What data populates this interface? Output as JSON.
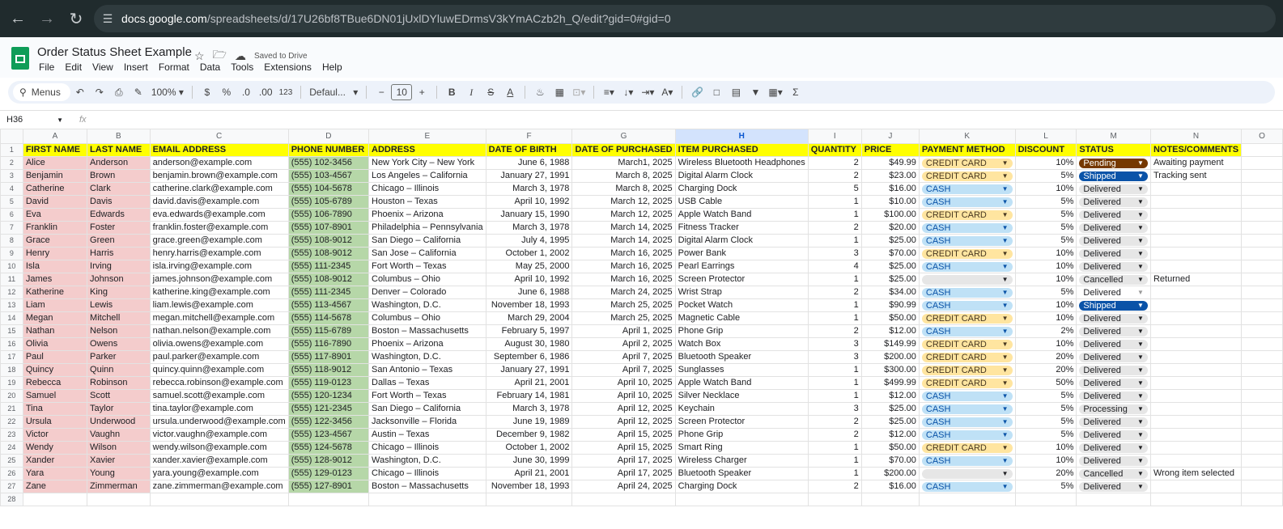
{
  "browser": {
    "url_domain": "docs.google.com",
    "url_path": "/spreadsheets/d/17U26bf8TBue6DN01jUxlDYluwEDrmsV3kYmACzb2h_Q/edit?gid=0#gid=0"
  },
  "doc": {
    "title": "Order Status Sheet Example",
    "saved": "Saved to Drive",
    "menu": [
      "File",
      "Edit",
      "View",
      "Insert",
      "Format",
      "Data",
      "Tools",
      "Extensions",
      "Help"
    ]
  },
  "toolbar": {
    "menus": "Menus",
    "zoom": "100%",
    "currency": "$",
    "percent": "%",
    "dec_dec": ".0",
    "dec_inc": ".00",
    "fmt123": "123",
    "font": "Defaul...",
    "font_size": "10"
  },
  "formula_bar": {
    "cell": "H36",
    "fx": "fx"
  },
  "columns": [
    "A",
    "B",
    "C",
    "D",
    "E",
    "F",
    "G",
    "H",
    "I",
    "J",
    "K",
    "L",
    "M",
    "N",
    "O"
  ],
  "headers": [
    "FIRST NAME",
    "LAST NAME",
    "EMAIL ADDRESS",
    "PHONE NUMBER",
    "ADDRESS",
    "DATE OF BIRTH",
    "DATE OF PURCHASED",
    "ITEM PURCHASED",
    "QUANTITY",
    "PRICE",
    "PAYMENT METHOD",
    "DISCOUNT",
    "STATUS",
    "NOTES/COMMENTS"
  ],
  "rows": [
    [
      "Alice",
      "Anderson",
      "anderson@example.com",
      "(555) 102-3456",
      "New York City – New York",
      "June 6, 1988",
      "March1, 2025",
      "Wireless Bluetooth Headphones",
      "2",
      "$49.99",
      "CREDIT CARD",
      "10%",
      "Pending",
      "Awaiting payment"
    ],
    [
      "Benjamin",
      "Brown",
      "benjamin.brown@example.com",
      "(555) 103-4567",
      "Los Angeles – California",
      "January 27, 1991",
      "March 8, 2025",
      "Digital Alarm Clock",
      "2",
      "$23.00",
      "CREDIT CARD",
      "5%",
      "Shipped",
      "Tracking sent"
    ],
    [
      "Catherine",
      "Clark",
      "catherine.clark@example.com",
      "(555) 104-5678",
      "Chicago – Illinois",
      "March 3, 1978",
      "March 8, 2025",
      "Charging Dock",
      "5",
      "$16.00",
      "CASH",
      "10%",
      "Delivered",
      ""
    ],
    [
      "David",
      "Davis",
      "david.davis@example.com",
      "(555) 105-6789",
      "Houston – Texas",
      "April 10, 1992",
      "March 12, 2025",
      "USB Cable",
      "1",
      "$10.00",
      "CASH",
      "5%",
      "Delivered",
      ""
    ],
    [
      "Eva",
      "Edwards",
      "eva.edwards@example.com",
      "(555) 106-7890",
      "Phoenix – Arizona",
      "January 15, 1990",
      "March 12, 2025",
      "Apple Watch Band",
      "1",
      "$100.00",
      "CREDIT CARD",
      "5%",
      "Delivered",
      ""
    ],
    [
      "Franklin",
      "Foster",
      "franklin.foster@example.com",
      "(555) 107-8901",
      "Philadelphia – Pennsylvania",
      "March 3, 1978",
      "March 14, 2025",
      "Fitness Tracker",
      "2",
      "$20.00",
      "CASH",
      "5%",
      "Delivered",
      ""
    ],
    [
      "Grace",
      "Green",
      "grace.green@example.com",
      "(555) 108-9012",
      "San Diego – California",
      "July 4, 1995",
      "March 14, 2025",
      "Digital Alarm Clock",
      "1",
      "$25.00",
      "CASH",
      "5%",
      "Delivered",
      ""
    ],
    [
      "Henry",
      "Harris",
      "henry.harris@example.com",
      "(555) 108-9012",
      "San Jose – California",
      "October 1, 2002",
      "March 16, 2025",
      "Power Bank",
      "3",
      "$70.00",
      "CREDIT CARD",
      "10%",
      "Delivered",
      ""
    ],
    [
      "Isla",
      "Irving",
      "isla.irving@example.com",
      "(555) 111-2345",
      "Fort Worth – Texas",
      "May 25, 2000",
      "March 16, 2025",
      "Pearl Earrings",
      "4",
      "$25.00",
      "CASH",
      "10%",
      "Delivered",
      ""
    ],
    [
      "James",
      "Johnson",
      "james.johnson@example.com",
      "(555) 108-9012",
      "Columbus – Ohio",
      "April 10, 1992",
      "March 16, 2025",
      "Screen Protector",
      "1",
      "$25.00",
      "",
      "10%",
      "Cancelled",
      "Returned"
    ],
    [
      "Katherine",
      "King",
      "katherine.king@example.com",
      "(555) 111-2345",
      "Denver – Colorado",
      "June 6, 1988",
      "March 24, 2025",
      "Wrist Strap",
      "2",
      "$34.00",
      "CASH",
      "5%",
      "Delivered",
      ""
    ],
    [
      "Liam",
      "Lewis",
      "liam.lewis@example.com",
      "(555) 113-4567",
      "Washington, D.C.",
      "November 18, 1993",
      "March 25, 2025",
      "Pocket Watch",
      "1",
      "$90.99",
      "CASH",
      "10%",
      "Shipped",
      ""
    ],
    [
      "Megan",
      "Mitchell",
      "megan.mitchell@example.com",
      "(555) 114-5678",
      "Columbus – Ohio",
      "March 29, 2004",
      "March 25, 2025",
      " Magnetic Cable",
      "1",
      "$50.00",
      "CREDIT CARD",
      "10%",
      "Delivered",
      ""
    ],
    [
      "Nathan",
      "Nelson",
      "nathan.nelson@example.com",
      "(555) 115-6789",
      "Boston – Massachusetts",
      "February 5, 1997",
      "April 1, 2025",
      "Phone Grip",
      "2",
      "$12.00",
      "CASH",
      "2%",
      "Delivered",
      ""
    ],
    [
      "Olivia",
      "Owens",
      "olivia.owens@example.com",
      "(555) 116-7890",
      "Phoenix – Arizona",
      "August 30, 1980",
      "April 2, 2025",
      "Watch Box",
      "3",
      "$149.99",
      "CREDIT CARD",
      "10%",
      "Delivered",
      ""
    ],
    [
      "Paul",
      "Parker",
      "paul.parker@example.com",
      "(555) 117-8901",
      "Washington, D.C.",
      "September 6, 1986",
      "April 7, 2025",
      "Bluetooth Speaker",
      "3",
      "$200.00",
      "CREDIT CARD",
      "20%",
      "Delivered",
      ""
    ],
    [
      "Quincy",
      "Quinn",
      "quincy.quinn@example.com",
      "(555) 118-9012",
      "San Antonio – Texas",
      "January 27, 1991",
      "April 7, 2025",
      "Sunglasses",
      "1",
      "$300.00",
      "CREDIT CARD",
      "20%",
      "Delivered",
      ""
    ],
    [
      "Rebecca",
      "Robinson",
      "rebecca.robinson@example.com",
      "(555) 119-0123",
      "Dallas – Texas",
      "April 21, 2001",
      "April 10, 2025",
      "Apple Watch Band",
      "1",
      "$499.99",
      "CREDIT CARD",
      "50%",
      "Delivered",
      ""
    ],
    [
      "Samuel",
      "Scott",
      "samuel.scott@example.com",
      "(555) 120-1234",
      "Fort Worth – Texas",
      "February 14, 1981",
      "April 10, 2025",
      "Silver Necklace",
      "1",
      "$12.00",
      "CASH",
      "5%",
      "Delivered",
      ""
    ],
    [
      "Tina",
      "Taylor",
      "tina.taylor@example.com",
      "(555) 121-2345",
      "San Diego – California",
      "March 3, 1978",
      "April 12, 2025",
      "Keychain",
      "3",
      "$25.00",
      "CASH",
      "5%",
      "Processing",
      ""
    ],
    [
      "Ursula",
      "Underwood",
      "ursula.underwood@example.com",
      "(555) 122-3456",
      "Jacksonville – Florida",
      "June 19, 1989",
      "April 12, 2025",
      "Screen Protector",
      "2",
      "$25.00",
      "CASH",
      "5%",
      "Delivered",
      ""
    ],
    [
      "Victor",
      "Vaughn",
      "victor.vaughn@example.com",
      "(555) 123-4567",
      "Austin – Texas",
      "December 9, 1982",
      "April 15, 2025",
      "Phone Grip",
      "2",
      "$12.00",
      "CASH",
      "5%",
      "Delivered",
      ""
    ],
    [
      "Wendy",
      "Wilson",
      "wendy.wilson@example.com",
      "(555) 124-5678",
      "Chicago – Illinois",
      "October 1, 2002",
      "April 15, 2025",
      " Smart Ring",
      "1",
      "$50.00",
      "CREDIT CARD",
      "10%",
      "Delivered",
      ""
    ],
    [
      "Xander",
      "Xavier",
      "xander.xavier@example.com",
      "(555) 128-9012",
      "Washington, D.C.",
      "June 30, 1999",
      "April 17, 2025",
      "Wireless Charger",
      "1",
      "$70.00",
      "CASH",
      "10%",
      "Delivered",
      ""
    ],
    [
      "Yara",
      "Young",
      "yara.young@example.com",
      "(555) 129-0123",
      "Chicago – Illinois",
      "April 21, 2001",
      "April 17, 2025",
      "Bluetooth Speaker",
      "1",
      "$200.00",
      "",
      "20%",
      "Cancelled",
      "Wrong item selected"
    ],
    [
      "Zane",
      "Zimmerman",
      "zane.zimmerman@example.com",
      "(555) 127-8901",
      "Boston – Massachusetts",
      "November 18, 1993",
      "April 24, 2025",
      "Charging Dock",
      "2",
      "$16.00",
      "CASH",
      "5%",
      "Delivered",
      ""
    ]
  ],
  "colors": {
    "header_yellow": "#ffff00",
    "name_pink": "#f4cccc",
    "phone_green": "#b6d7a8",
    "credit_chip": "#ffe5a0",
    "cash_chip": "#bfe1f6",
    "pending_chip": "#753800",
    "shipped_chip": "#0a53a8"
  }
}
